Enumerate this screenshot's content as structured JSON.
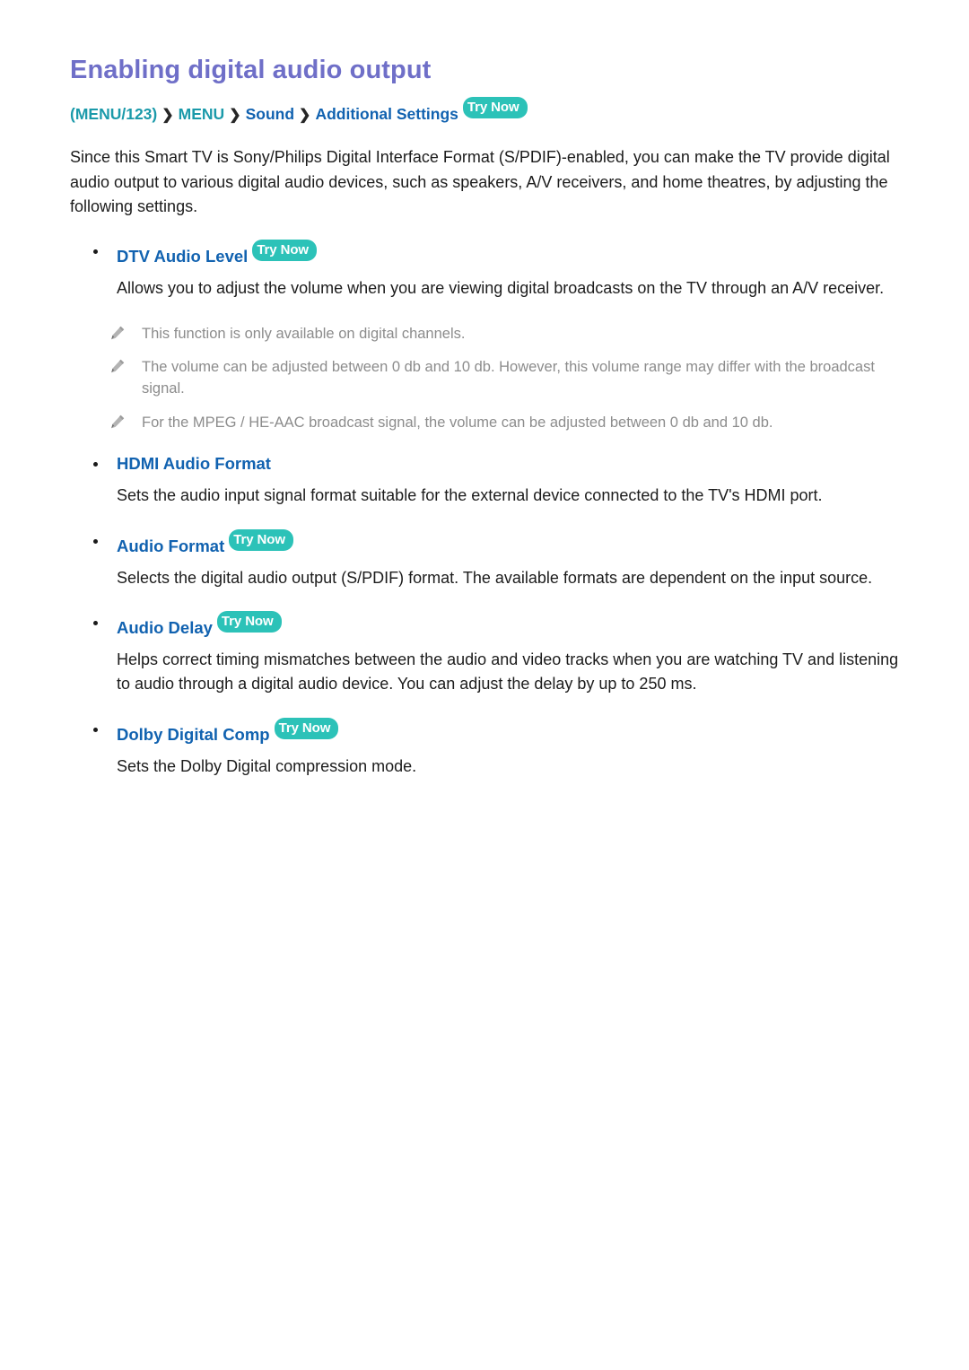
{
  "page": {
    "title": "Enabling digital audio output"
  },
  "breadcrumb": {
    "menu123": "(MENU/123)",
    "sep1": "❯",
    "menu": "MENU",
    "sep2": "❯",
    "sound": "Sound",
    "sep3": "❯",
    "additional_settings": "Additional Settings",
    "try_now": "Try Now"
  },
  "intro": "Since this Smart TV is Sony/Philips Digital Interface Format (S/PDIF)-enabled, you can make the TV provide digital audio output to various digital audio devices, such as speakers, A/V receivers, and home theatres, by adjusting the following settings.",
  "sections": [
    {
      "label": "DTV Audio Level",
      "try_now": "Try Now",
      "description": "Allows you to adjust the volume when you are viewing digital broadcasts on the TV through an A/V receiver.",
      "notes": [
        "This function is only available on digital channels.",
        "The volume can be adjusted between 0 db and 10 db. However, this volume range may differ with the broadcast signal.",
        "For the MPEG / HE-AAC broadcast signal, the volume can be adjusted between 0 db and 10 db."
      ]
    },
    {
      "label": "HDMI Audio Format",
      "try_now": "",
      "description": "Sets the audio input signal format suitable for the external device connected to the TV's HDMI port.",
      "notes": []
    },
    {
      "label": "Audio Format",
      "try_now": "Try Now",
      "description": "Selects the digital audio output (S/PDIF) format. The available formats are dependent on the input source.",
      "notes": []
    },
    {
      "label": "Audio Delay",
      "try_now": "Try Now",
      "description": "Helps correct timing mismatches between the audio and video tracks when you are watching TV and listening to audio through a digital audio device. You can adjust the delay by up to 250 ms.",
      "notes": []
    },
    {
      "label": "Dolby Digital Comp",
      "try_now": "Try Now",
      "description": "Sets the Dolby Digital compression mode.",
      "notes": []
    }
  ],
  "colors": {
    "title": "#6f6fc8",
    "heading_blue": "#1162b0",
    "breadcrumb_teal": "#1b9aaa",
    "badge_teal": "#2cc2b8",
    "note_gray": "#8c8c8c",
    "body": "#1c1c1c"
  },
  "icons": {
    "pencil": "pencil-icon",
    "chevron": "chevron-right-icon"
  }
}
